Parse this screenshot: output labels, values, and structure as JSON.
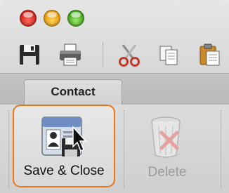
{
  "title_bar": {
    "buttons": [
      "close",
      "minimize",
      "zoom"
    ]
  },
  "toolbar": {
    "icons": [
      "save-icon",
      "print-icon",
      "cut-icon",
      "copy-icon",
      "paste-icon"
    ]
  },
  "tabs": {
    "active_label": "Contact"
  },
  "ribbon": {
    "save_close_label": "Save & Close",
    "delete_label": "Delete"
  },
  "colors": {
    "highlight": "#e8761b",
    "close": "#d0211a",
    "minimize": "#e69a0c",
    "zoom": "#3fa51b"
  }
}
